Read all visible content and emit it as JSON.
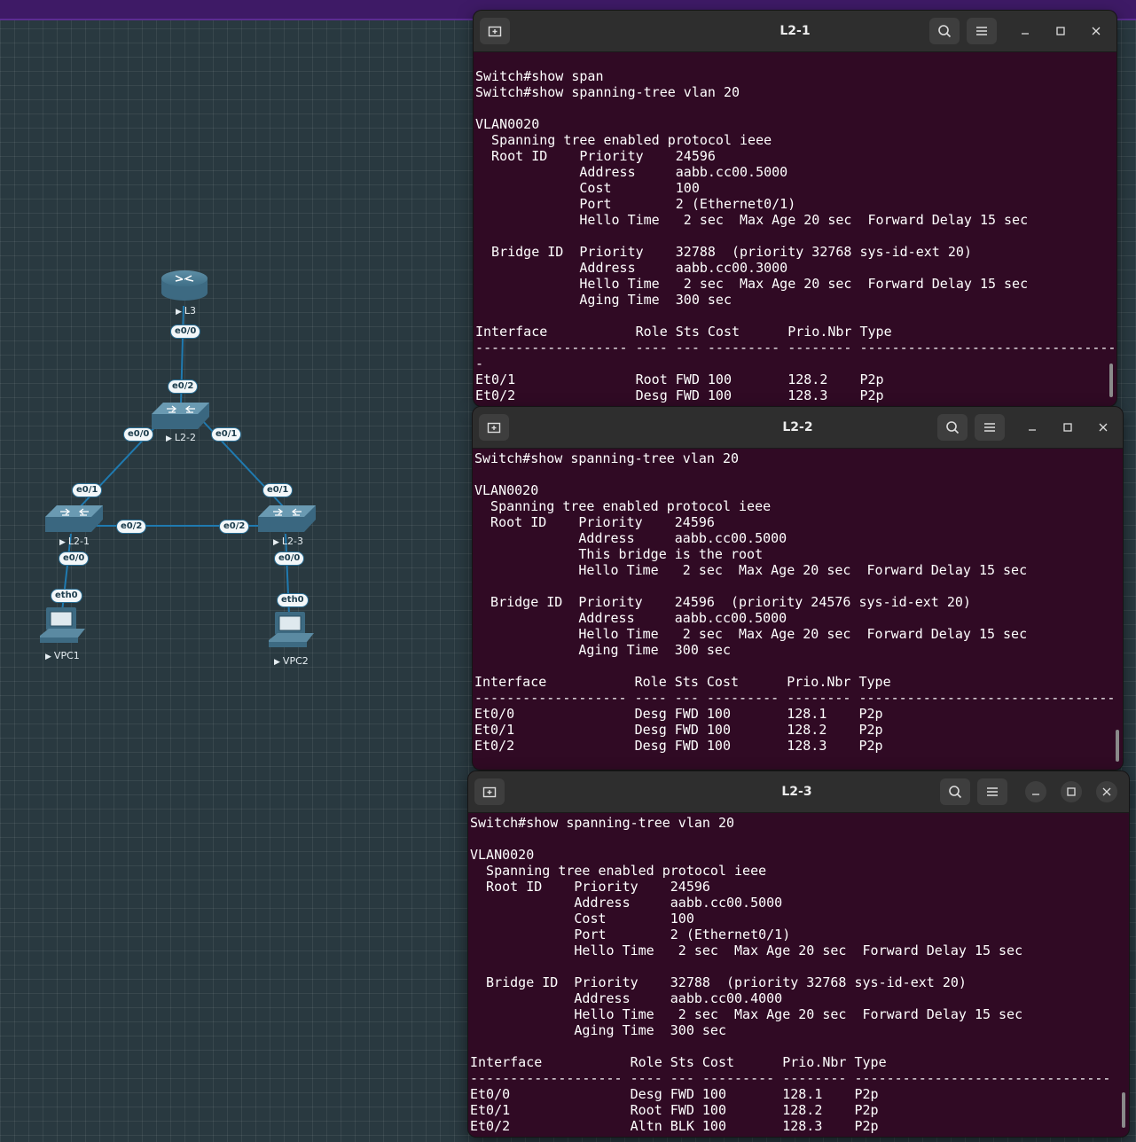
{
  "topology": {
    "nodes": [
      {
        "id": "L3",
        "label": "L3"
      },
      {
        "id": "L2-2",
        "label": "L2-2"
      },
      {
        "id": "L2-1",
        "label": "L2-1"
      },
      {
        "id": "L2-3",
        "label": "L2-3"
      },
      {
        "id": "VPC1",
        "label": "VPC1"
      },
      {
        "id": "VPC2",
        "label": "VPC2"
      }
    ],
    "ports": {
      "l3_e00": "e0/0",
      "l22_e02": "e0/2",
      "l22_e00": "e0/0",
      "l22_e01": "e0/1",
      "l21_e01": "e0/1",
      "l21_e02": "e0/2",
      "l21_e00": "e0/0",
      "l23_e01": "e0/1",
      "l23_e02": "e0/2",
      "l23_e00": "e0/0",
      "vpc1_eth0": "eth0",
      "vpc2_eth0": "eth0"
    }
  },
  "terminals": [
    {
      "title": "L2-1",
      "lines": [
        "",
        "Switch#show span",
        "Switch#show spanning-tree vlan 20",
        "",
        "VLAN0020",
        "  Spanning tree enabled protocol ieee",
        "  Root ID    Priority    24596",
        "             Address     aabb.cc00.5000",
        "             Cost        100",
        "             Port        2 (Ethernet0/1)",
        "             Hello Time   2 sec  Max Age 20 sec  Forward Delay 15 sec",
        "",
        "  Bridge ID  Priority    32788  (priority 32768 sys-id-ext 20)",
        "             Address     aabb.cc00.3000",
        "             Hello Time   2 sec  Max Age 20 sec  Forward Delay 15 sec",
        "             Aging Time  300 sec",
        "",
        "Interface           Role Sts Cost      Prio.Nbr Type",
        "------------------- ---- --- --------- -------- --------------------------------",
        "-",
        "Et0/1               Root FWD 100       128.2    P2p",
        "Et0/2               Desg FWD 100       128.3    P2p"
      ]
    },
    {
      "title": "L2-2",
      "lines": [
        "Switch#show spanning-tree vlan 20",
        "",
        "VLAN0020",
        "  Spanning tree enabled protocol ieee",
        "  Root ID    Priority    24596",
        "             Address     aabb.cc00.5000",
        "             This bridge is the root",
        "             Hello Time   2 sec  Max Age 20 sec  Forward Delay 15 sec",
        "",
        "  Bridge ID  Priority    24596  (priority 24576 sys-id-ext 20)",
        "             Address     aabb.cc00.5000",
        "             Hello Time   2 sec  Max Age 20 sec  Forward Delay 15 sec",
        "             Aging Time  300 sec",
        "",
        "Interface           Role Sts Cost      Prio.Nbr Type",
        "------------------- ---- --- --------- -------- --------------------------------",
        "Et0/0               Desg FWD 100       128.1    P2p",
        "Et0/1               Desg FWD 100       128.2    P2p",
        "Et0/2               Desg FWD 100       128.3    P2p"
      ]
    },
    {
      "title": "L2-3",
      "lines": [
        "Switch#show spanning-tree vlan 20",
        "",
        "VLAN0020",
        "  Spanning tree enabled protocol ieee",
        "  Root ID    Priority    24596",
        "             Address     aabb.cc00.5000",
        "             Cost        100",
        "             Port        2 (Ethernet0/1)",
        "             Hello Time   2 sec  Max Age 20 sec  Forward Delay 15 sec",
        "",
        "  Bridge ID  Priority    32788  (priority 32768 sys-id-ext 20)",
        "             Address     aabb.cc00.4000",
        "             Hello Time   2 sec  Max Age 20 sec  Forward Delay 15 sec",
        "             Aging Time  300 sec",
        "",
        "Interface           Role Sts Cost      Prio.Nbr Type",
        "------------------- ---- --- --------- -------- --------------------------------",
        "Et0/0               Desg FWD 100       128.1    P2p",
        "Et0/1               Root FWD 100       128.2    P2p",
        "Et0/2               Altn BLK 100       128.3    P2p"
      ]
    }
  ],
  "icons": {
    "new_tab": "new-tab-icon",
    "search": "search-icon",
    "menu": "hamburger-menu-icon",
    "minimize": "minimize-icon",
    "maximize": "maximize-icon",
    "close": "close-icon"
  },
  "colors": {
    "terminal_bg": "#300a24",
    "titlebar_bg": "#2e2e2e",
    "canvas_bg": "#293940",
    "link": "#1f7ab0",
    "top_bar": "#3e1a66"
  }
}
